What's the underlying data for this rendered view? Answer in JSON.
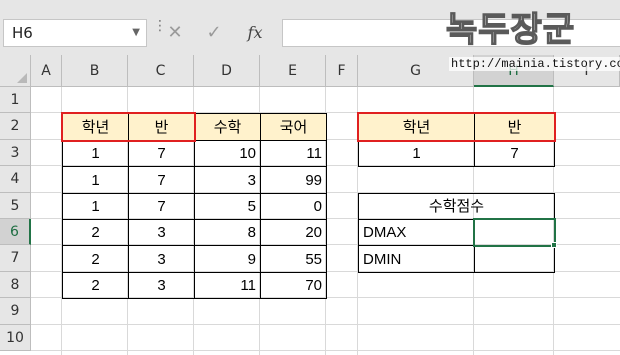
{
  "name_box": {
    "value": "H6"
  },
  "formula_bar": {
    "cancel_icon": "✕",
    "enter_icon": "✓",
    "fx_label": "fx",
    "value": ""
  },
  "watermark": {
    "text": "녹두장군",
    "url": "http://mainia.tistory.com"
  },
  "columns": [
    "A",
    "B",
    "C",
    "D",
    "E",
    "F",
    "G",
    "H",
    "I"
  ],
  "rows": [
    "1",
    "2",
    "3",
    "4",
    "5",
    "6",
    "7",
    "8",
    "9",
    "10"
  ],
  "selection": {
    "column": "H",
    "row": "6"
  },
  "table1": {
    "headers": [
      "학년",
      "반",
      "수학",
      "국어"
    ],
    "rows": [
      [
        "1",
        "7",
        "10",
        "11"
      ],
      [
        "1",
        "7",
        "3",
        "99"
      ],
      [
        "1",
        "7",
        "5",
        "0"
      ],
      [
        "2",
        "3",
        "8",
        "20"
      ],
      [
        "2",
        "3",
        "9",
        "55"
      ],
      [
        "2",
        "3",
        "11",
        "70"
      ]
    ]
  },
  "criteria": {
    "headers": [
      "학년",
      "반"
    ],
    "values": [
      "1",
      "7"
    ]
  },
  "result": {
    "title": "수학점수",
    "labels": [
      "DMAX",
      "DMIN"
    ],
    "values": [
      "",
      ""
    ]
  },
  "colors": {
    "header_fill": "#fff2cc",
    "highlight_border": "#e02020",
    "selection": "#217346"
  }
}
